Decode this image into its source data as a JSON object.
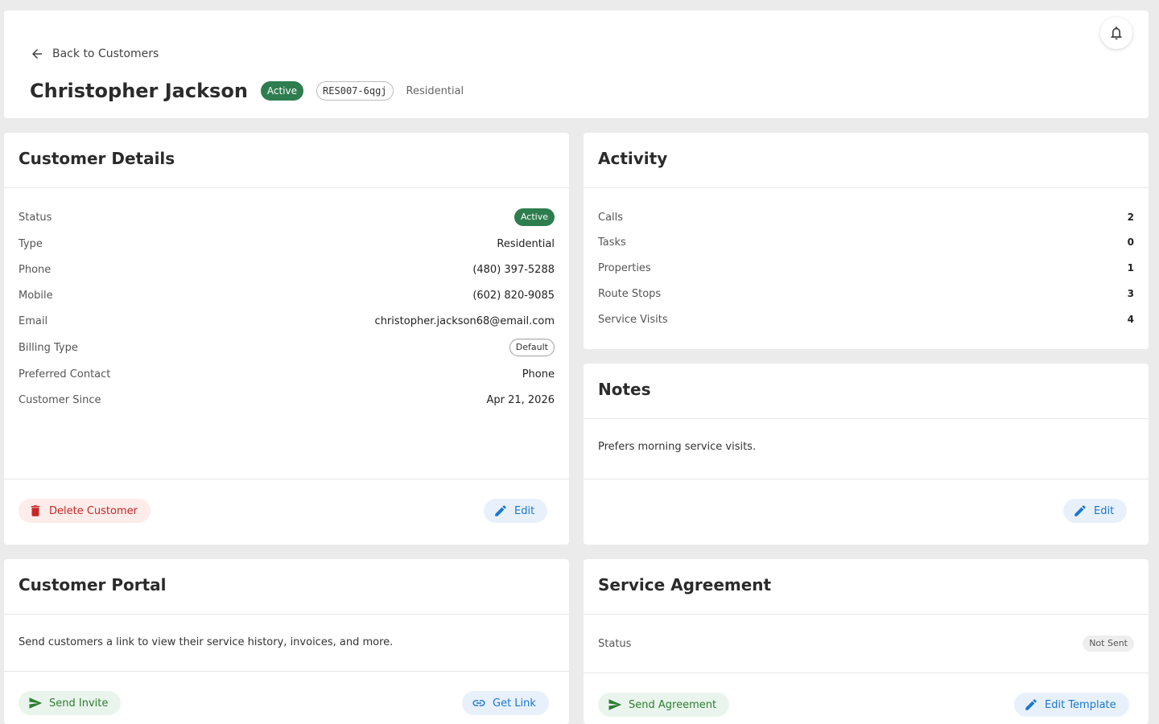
{
  "header": {
    "back_label": "Back to Customers",
    "customer_name": "Christopher Jackson",
    "status_chip": "Active",
    "customer_id": "RES007-6qgj",
    "customer_type": "Residential"
  },
  "details": {
    "title": "Customer Details",
    "rows": [
      {
        "label": "Status",
        "value": "Active"
      },
      {
        "label": "Type",
        "value": "Residential"
      },
      {
        "label": "Phone",
        "value": "(480) 397-5288"
      },
      {
        "label": "Mobile",
        "value": "(602) 820-9085"
      },
      {
        "label": "Email",
        "value": "christopher.jackson68@email.com"
      },
      {
        "label": "Billing Type",
        "value": "Default"
      },
      {
        "label": "Preferred Contact",
        "value": "Phone"
      },
      {
        "label": "Customer Since",
        "value": "Apr 21, 2026"
      }
    ],
    "delete_label": "Delete Customer",
    "edit_label": "Edit"
  },
  "activity": {
    "title": "Activity",
    "rows": [
      {
        "label": "Calls",
        "value": "2"
      },
      {
        "label": "Tasks",
        "value": "0"
      },
      {
        "label": "Properties",
        "value": "1"
      },
      {
        "label": "Route Stops",
        "value": "3"
      },
      {
        "label": "Service Visits",
        "value": "4"
      }
    ]
  },
  "notes": {
    "title": "Notes",
    "text": "Prefers morning service visits.",
    "edit_label": "Edit"
  },
  "portal": {
    "title": "Customer Portal",
    "description": "Send customers a link to view their service history, invoices, and more.",
    "send_invite_label": "Send Invite",
    "get_link_label": "Get Link"
  },
  "agreement": {
    "title": "Service Agreement",
    "status_label": "Status",
    "status_value": "Not Sent",
    "send_label": "Send Agreement",
    "edit_template_label": "Edit Template"
  },
  "colors": {
    "success": "#2e7d4f",
    "danger": "#c62828",
    "primary": "#1976d2",
    "background": "#ebebeb"
  }
}
